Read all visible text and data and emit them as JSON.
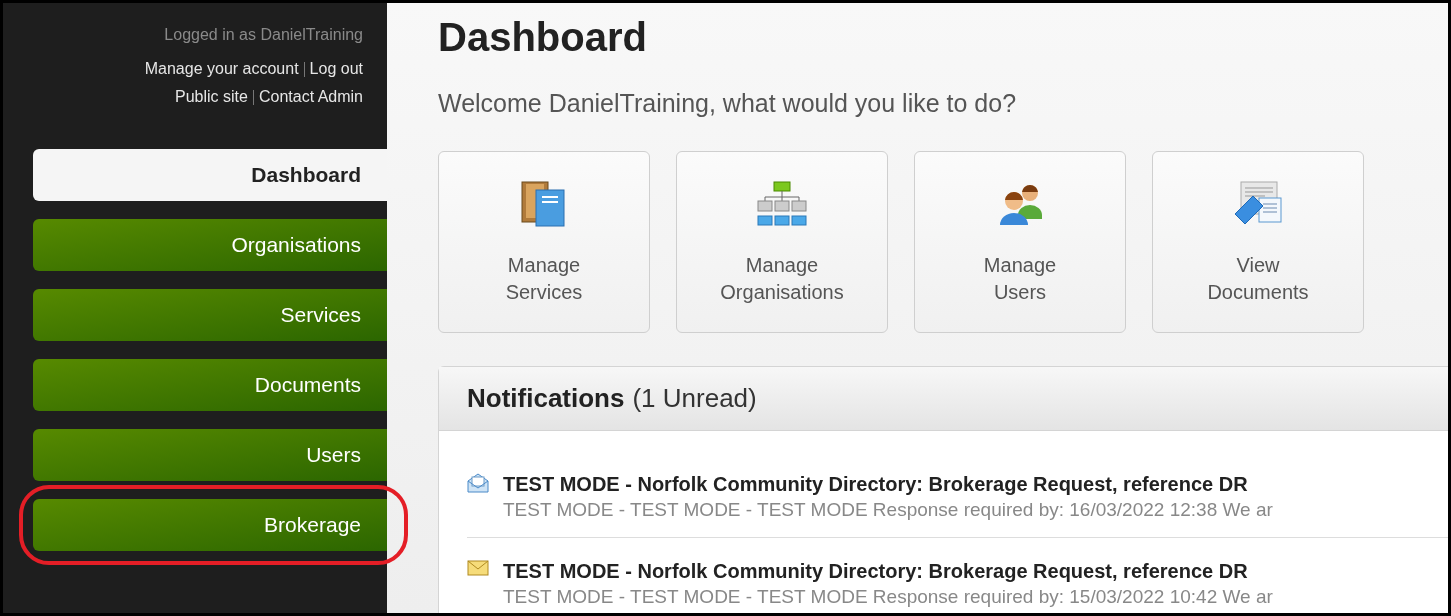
{
  "account": {
    "logged_in_as": "Logged in as DanielTraining",
    "links_row_1": [
      "Manage your account",
      "Log out"
    ],
    "links_row_2": [
      "Public site",
      "Contact Admin"
    ]
  },
  "nav": [
    {
      "label": "Dashboard",
      "selected": true,
      "highlighted": false
    },
    {
      "label": "Organisations",
      "selected": false,
      "highlighted": false
    },
    {
      "label": "Services",
      "selected": false,
      "highlighted": false
    },
    {
      "label": "Documents",
      "selected": false,
      "highlighted": false
    },
    {
      "label": "Users",
      "selected": false,
      "highlighted": false
    },
    {
      "label": "Brokerage",
      "selected": false,
      "highlighted": true
    }
  ],
  "title": "Dashboard",
  "welcome": "Welcome DanielTraining, what would you like to do?",
  "tiles": [
    {
      "kind": "books",
      "line_1": "Manage",
      "line_2": "Services"
    },
    {
      "kind": "hierarchy",
      "line_1": "Manage",
      "line_2": "Organisations"
    },
    {
      "kind": "people",
      "line_1": "Manage",
      "line_2": "Users"
    },
    {
      "kind": "documents",
      "line_1": "View",
      "line_2": "Documents"
    }
  ],
  "notifications": {
    "title": "Notifications",
    "count": "(1 Unread)",
    "items": [
      {
        "read": true,
        "subject": "TEST MODE - Norfolk Community Directory: Brokerage Request, reference DR",
        "summary": "TEST MODE - TEST MODE - TEST MODE Response required by: 16/03/2022 12:38 We ar"
      },
      {
        "read": false,
        "subject": "TEST MODE - Norfolk Community Directory: Brokerage Request, reference DR",
        "summary": "TEST MODE - TEST MODE - TEST MODE Response required by: 15/03/2022 10:42 We ar"
      }
    ]
  }
}
